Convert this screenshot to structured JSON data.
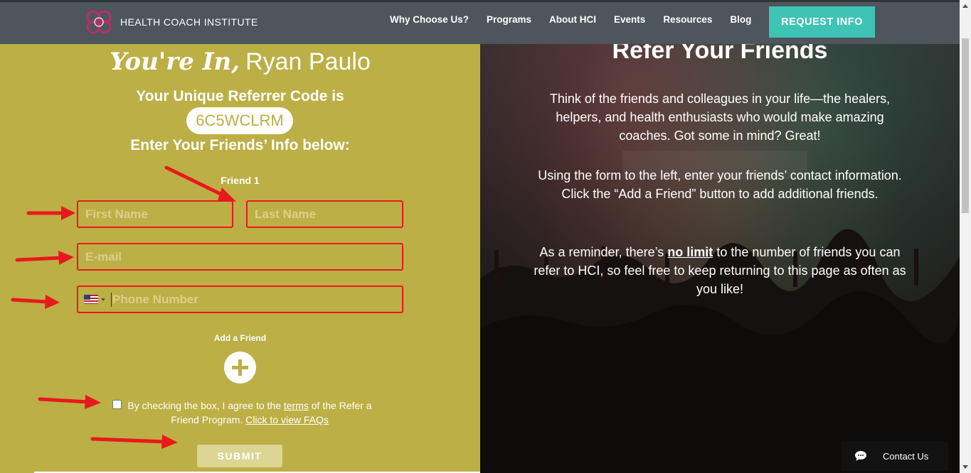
{
  "header": {
    "brand": "HEALTH COACH INSTITUTE",
    "nav": [
      "Why Choose Us?",
      "Programs",
      "About HCI",
      "Events",
      "Resources",
      "Blog"
    ],
    "cta": "REQUEST INFO"
  },
  "left": {
    "script_text": "You're In,",
    "user_name": "Ryan Paulo",
    "referrer_title": "Your Unique Referrer Code is",
    "referrer_code": "6C5WCLRM",
    "enter_info": "Enter Your Friends’ Info below:",
    "friend_label": "Friend 1",
    "first_name_placeholder": "First Name",
    "last_name_placeholder": "Last Name",
    "email_placeholder": "E-mail",
    "phone_placeholder": "Phone Number",
    "add_friend": "Add a Friend",
    "agree_prefix": "By checking the box, I agree to the",
    "agree_terms": "terms",
    "agree_mid": "of the Refer a Friend Program.",
    "agree_faq": "Click to view FAQs",
    "submit": "SUBMIT"
  },
  "right": {
    "title": "Refer Your Friends",
    "p1": "Think of the friends and colleagues in your life—the healers, helpers, and health enthusiasts who would make amazing coaches. Got some in mind? Great!",
    "p2": "Using the form to the left, enter your friends’ contact information. Click the “Add a Friend” button to add additional friends.",
    "p3_prefix": "As a reminder, there’s",
    "p3_emph": "no limit",
    "p3_suffix": "to the number of friends you can refer to HCI, so feel free to keep returning to this page as often as you like!"
  },
  "chat": {
    "label": "Contact Us",
    "icon": "chat-bubble-icon"
  },
  "colors": {
    "header_bg": "#4e555c",
    "accent": "#3fc3b4",
    "panel": "#bcaf45",
    "annotation_red": "#e8191c"
  }
}
